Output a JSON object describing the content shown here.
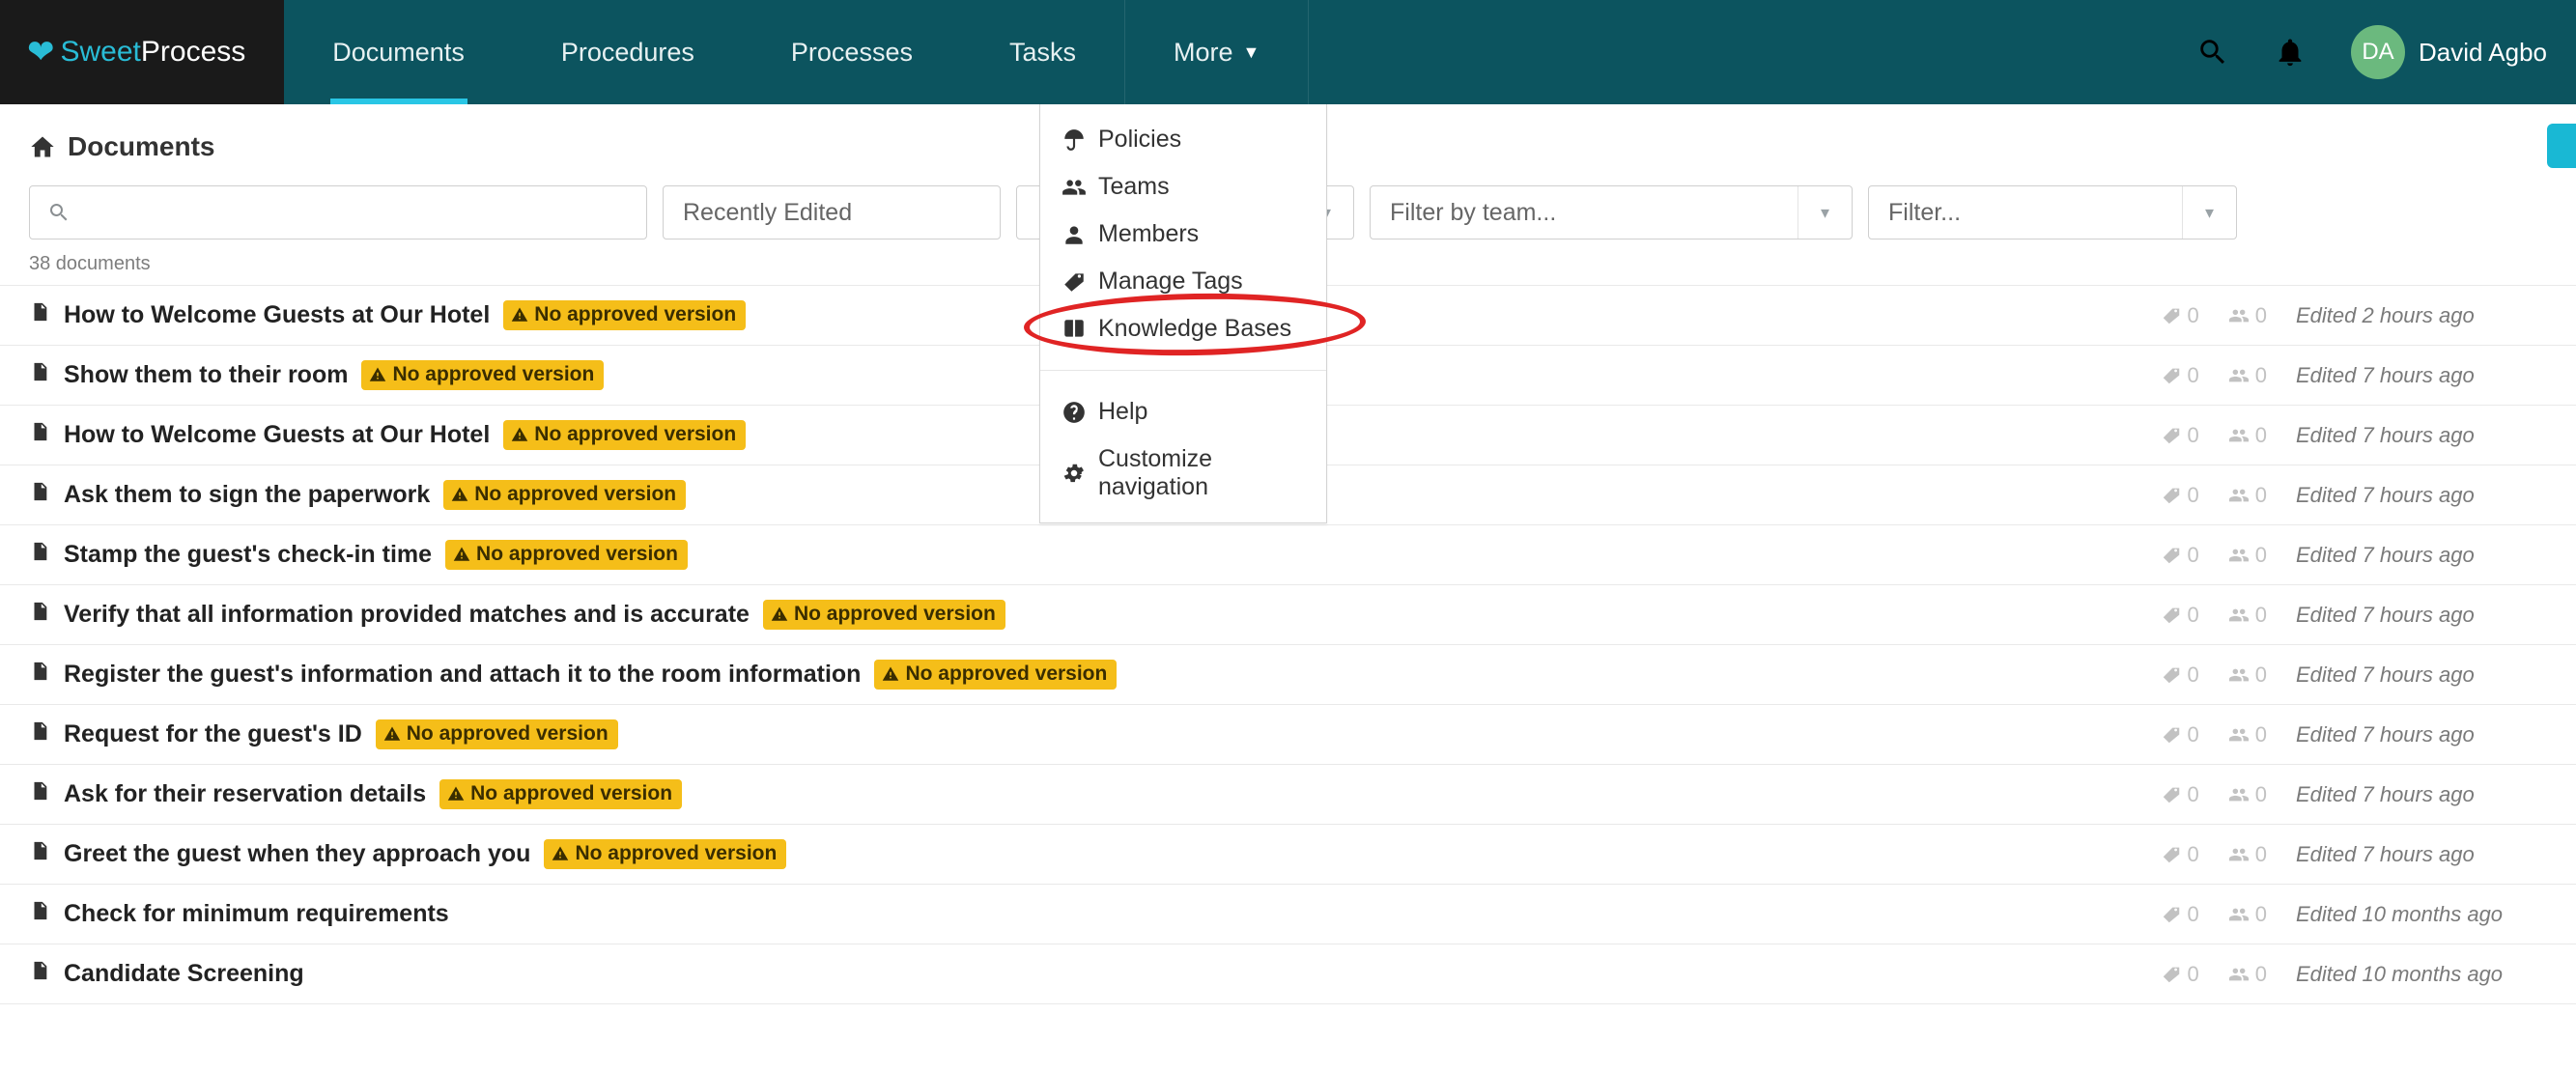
{
  "brand": {
    "part1": "Sweet",
    "part2": "Process"
  },
  "nav": {
    "documents": "Documents",
    "procedures": "Procedures",
    "processes": "Processes",
    "tasks": "Tasks",
    "more": "More"
  },
  "user": {
    "initials": "DA",
    "name": "David Agbo"
  },
  "breadcrumb": {
    "title": "Documents"
  },
  "dropdown": {
    "policies": "Policies",
    "teams": "Teams",
    "members": "Members",
    "manage_tags": "Manage Tags",
    "knowledge_bases": "Knowledge Bases",
    "help": "Help",
    "customize_nav": "Customize navigation"
  },
  "filters": {
    "search_placeholder": "",
    "recent_label": "Recently Edited",
    "team_placeholder": "Filter by team...",
    "filter_placeholder": "Filter..."
  },
  "count_line": "38 documents",
  "badge_text": "No approved version",
  "docs": [
    {
      "title": "How to Welcome Guests at Our Hotel",
      "badge": true,
      "type": "list",
      "tags": 0,
      "assignees": 0,
      "edited": "Edited 2 hours ago"
    },
    {
      "title": "Show them to their room",
      "badge": true,
      "type": "doc",
      "tags": 0,
      "assignees": 0,
      "edited": "Edited 7 hours ago"
    },
    {
      "title": "How to Welcome Guests at Our Hotel",
      "badge": true,
      "type": "list",
      "tags": 0,
      "assignees": 0,
      "edited": "Edited 7 hours ago"
    },
    {
      "title": "Ask them to sign the paperwork",
      "badge": true,
      "type": "doc",
      "tags": 0,
      "assignees": 0,
      "edited": "Edited 7 hours ago"
    },
    {
      "title": "Stamp the guest's check-in time",
      "badge": true,
      "type": "doc",
      "tags": 0,
      "assignees": 0,
      "edited": "Edited 7 hours ago"
    },
    {
      "title": "Verify that all information provided matches and is accurate",
      "badge": true,
      "type": "doc",
      "tags": 0,
      "assignees": 0,
      "edited": "Edited 7 hours ago"
    },
    {
      "title": "Register the guest's information and attach it to the room information",
      "badge": true,
      "type": "doc",
      "tags": 0,
      "assignees": 0,
      "edited": "Edited 7 hours ago"
    },
    {
      "title": "Request for the guest's ID",
      "badge": true,
      "type": "doc",
      "tags": 0,
      "assignees": 0,
      "edited": "Edited 7 hours ago"
    },
    {
      "title": "Ask for their reservation details",
      "badge": true,
      "type": "doc",
      "tags": 0,
      "assignees": 0,
      "edited": "Edited 7 hours ago"
    },
    {
      "title": "Greet the guest when they approach you",
      "badge": true,
      "type": "doc",
      "tags": 0,
      "assignees": 0,
      "edited": "Edited 7 hours ago"
    },
    {
      "title": "Check for minimum requirements",
      "badge": false,
      "type": "doc",
      "tags": 0,
      "assignees": 0,
      "edited": "Edited 10 months ago"
    },
    {
      "title": "Candidate Screening",
      "badge": false,
      "type": "list",
      "tags": 0,
      "assignees": 0,
      "edited": "Edited 10 months ago"
    }
  ]
}
